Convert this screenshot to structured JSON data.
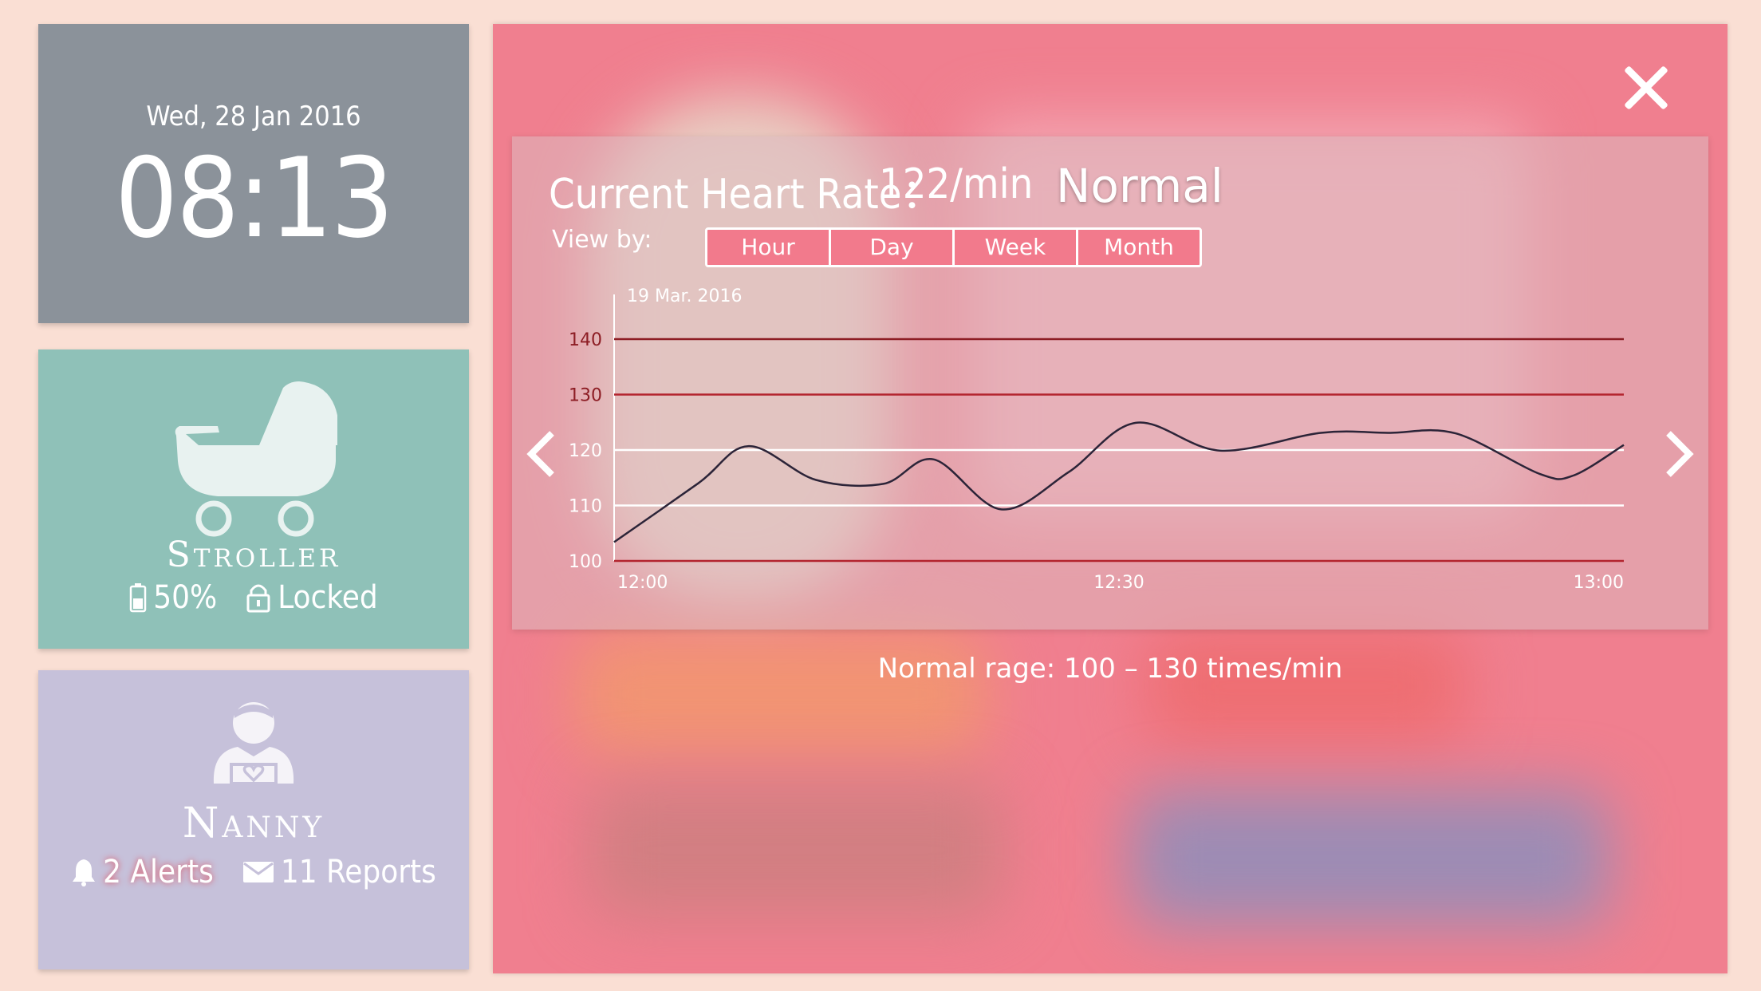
{
  "clock": {
    "date": "Wed,  28 Jan 2016",
    "time": "08:13"
  },
  "stroller": {
    "title": "Stroller",
    "battery_icon": "battery-icon",
    "battery": "50%",
    "lock_icon": "lock-icon",
    "lock_status": "Locked",
    "accent": "#8fc1b8"
  },
  "nanny": {
    "title": "Nanny",
    "bell_icon": "bell-icon",
    "alerts": "2 Alerts",
    "mail_icon": "mail-icon",
    "reports": "11 Reports",
    "accent": "#c6c1da"
  },
  "panel": {
    "heart_rate_label": "Current Heart Rate：",
    "heart_rate_value": "122/min",
    "status": "Normal",
    "view_by_label": "View by:",
    "tabs": [
      "Hour",
      "Day",
      "Week",
      "Month"
    ],
    "footer": "Normal rage: 100 – 130 times/min",
    "accent": "#f07f8f"
  },
  "chart_data": {
    "type": "line",
    "title": "19 Mar. 2016",
    "xlabel": "",
    "ylabel": "",
    "ylim": [
      100,
      140
    ],
    "yticks": [
      100,
      110,
      120,
      130,
      140
    ],
    "x_ticks": [
      "12:00",
      "12:30",
      "13:00"
    ],
    "x": [
      0,
      5,
      8,
      12,
      16,
      19,
      23,
      27,
      31,
      36,
      42,
      46,
      50,
      55,
      57,
      60
    ],
    "series": [
      {
        "values": [
          103.4,
          114,
          120.7,
          114.6,
          113.9,
          118.3,
          109.3,
          116,
          124.9,
          119.9,
          123.1,
          123.1,
          123,
          115.7,
          115.4,
          120.9
        ]
      }
    ],
    "grid_colors": {
      "100": "#b3242e",
      "110": "#ffffff",
      "120": "#ffffff",
      "130": "#b3242e",
      "140": "#8d1d24"
    }
  }
}
